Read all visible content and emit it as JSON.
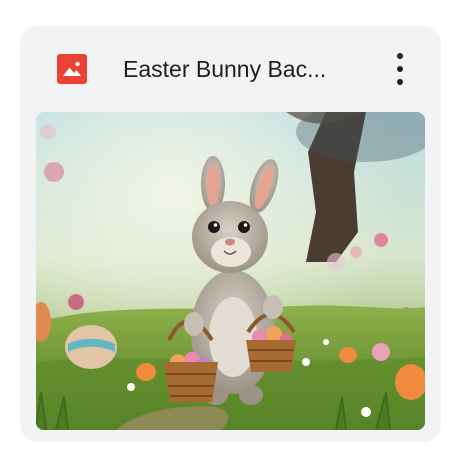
{
  "file_card": {
    "title": "Easter Bunny Bac...",
    "icon": "image-file-icon",
    "menu_icon": "more-vert-icon",
    "thumbnail_icon": "easter-bunny-image"
  },
  "colors": {
    "card_background": "#f1f3f4",
    "file_icon_red": "#ea4335",
    "title_text": "#1f1f1f",
    "menu_icon": "#1f1f1f"
  }
}
